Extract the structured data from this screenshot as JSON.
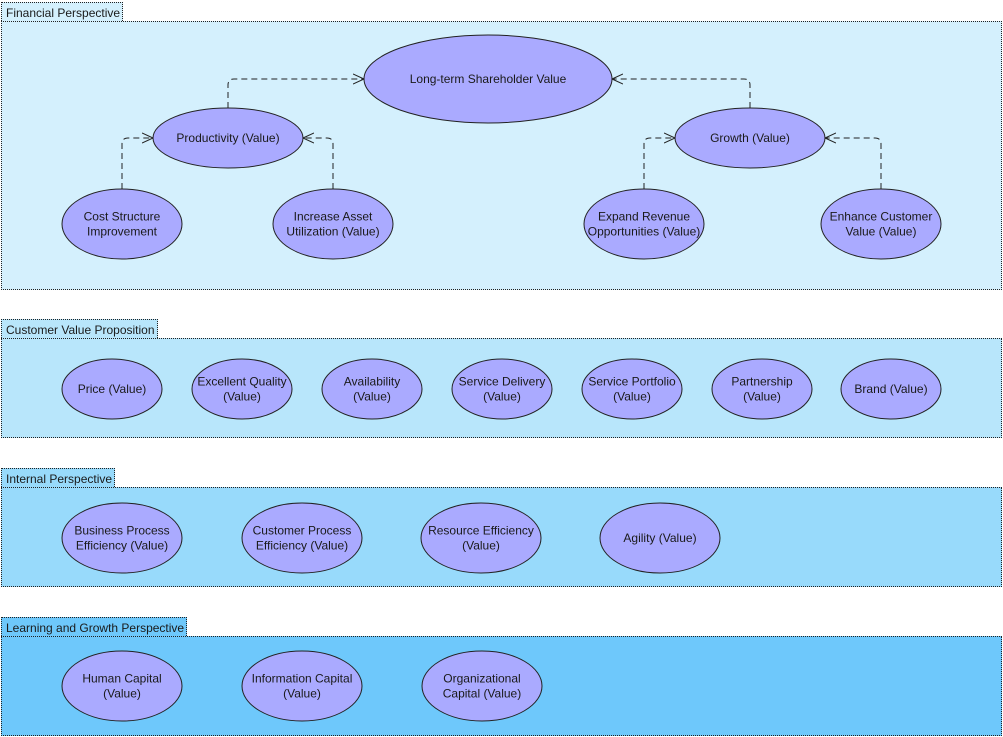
{
  "colors": {
    "node_fill": "#aaaaff",
    "node_stroke": "#222222",
    "lane_financial": "#d4f0fd",
    "lane_customer": "#b8e6fb",
    "lane_internal": "#98dafb",
    "lane_learning": "#6ec8fb",
    "connector": "#222222"
  },
  "lanes": [
    {
      "id": "financial",
      "title": "Financial Perspective"
    },
    {
      "id": "customer",
      "title": "Customer Value Proposition"
    },
    {
      "id": "internal",
      "title": "Internal Perspective"
    },
    {
      "id": "learning",
      "title": "Learning and Growth Perspective"
    }
  ],
  "nodes": [
    {
      "id": "shareholder",
      "lane": "financial",
      "lines": [
        "Long-term Shareholder Value"
      ]
    },
    {
      "id": "productivity",
      "lane": "financial",
      "lines": [
        "Productivity (Value)"
      ]
    },
    {
      "id": "growth",
      "lane": "financial",
      "lines": [
        "Growth (Value)"
      ]
    },
    {
      "id": "cost",
      "lane": "financial",
      "lines": [
        "Cost Structure",
        "Improvement"
      ]
    },
    {
      "id": "asset",
      "lane": "financial",
      "lines": [
        "Increase Asset",
        "Utilization (Value)"
      ]
    },
    {
      "id": "revenue",
      "lane": "financial",
      "lines": [
        "Expand Revenue",
        "Opportunities (Value)"
      ]
    },
    {
      "id": "enhance",
      "lane": "financial",
      "lines": [
        "Enhance Customer",
        "Value (Value)"
      ]
    },
    {
      "id": "price",
      "lane": "customer",
      "lines": [
        "Price (Value)"
      ]
    },
    {
      "id": "quality",
      "lane": "customer",
      "lines": [
        "Excellent Quality",
        "(Value)"
      ]
    },
    {
      "id": "availability",
      "lane": "customer",
      "lines": [
        "Availability",
        "(Value)"
      ]
    },
    {
      "id": "delivery",
      "lane": "customer",
      "lines": [
        "Service Delivery",
        "(Value)"
      ]
    },
    {
      "id": "portfolio",
      "lane": "customer",
      "lines": [
        "Service Portfolio",
        "(Value)"
      ]
    },
    {
      "id": "partnership",
      "lane": "customer",
      "lines": [
        "Partnership",
        "(Value)"
      ]
    },
    {
      "id": "brand",
      "lane": "customer",
      "lines": [
        "Brand (Value)"
      ]
    },
    {
      "id": "bpe",
      "lane": "internal",
      "lines": [
        "Business Process",
        "Efficiency (Value)"
      ]
    },
    {
      "id": "cpe",
      "lane": "internal",
      "lines": [
        "Customer Process",
        "Efficiency (Value)"
      ]
    },
    {
      "id": "resource",
      "lane": "internal",
      "lines": [
        "Resource Efficiency",
        "(Value)"
      ]
    },
    {
      "id": "agility",
      "lane": "internal",
      "lines": [
        "Agility (Value)"
      ]
    },
    {
      "id": "human",
      "lane": "learning",
      "lines": [
        "Human Capital",
        "(Value)"
      ]
    },
    {
      "id": "information",
      "lane": "learning",
      "lines": [
        "Information Capital",
        "(Value)"
      ]
    },
    {
      "id": "organizational",
      "lane": "learning",
      "lines": [
        "Organizational",
        "Capital (Value)"
      ]
    }
  ],
  "edges": [
    {
      "from": "productivity",
      "to": "shareholder",
      "style": "dashed-open-arrow"
    },
    {
      "from": "growth",
      "to": "shareholder",
      "style": "dashed-open-arrow"
    },
    {
      "from": "cost",
      "to": "productivity",
      "style": "dashed-open-arrow"
    },
    {
      "from": "asset",
      "to": "productivity",
      "style": "dashed-open-arrow"
    },
    {
      "from": "revenue",
      "to": "growth",
      "style": "dashed-open-arrow"
    },
    {
      "from": "enhance",
      "to": "growth",
      "style": "dashed-open-arrow"
    }
  ]
}
